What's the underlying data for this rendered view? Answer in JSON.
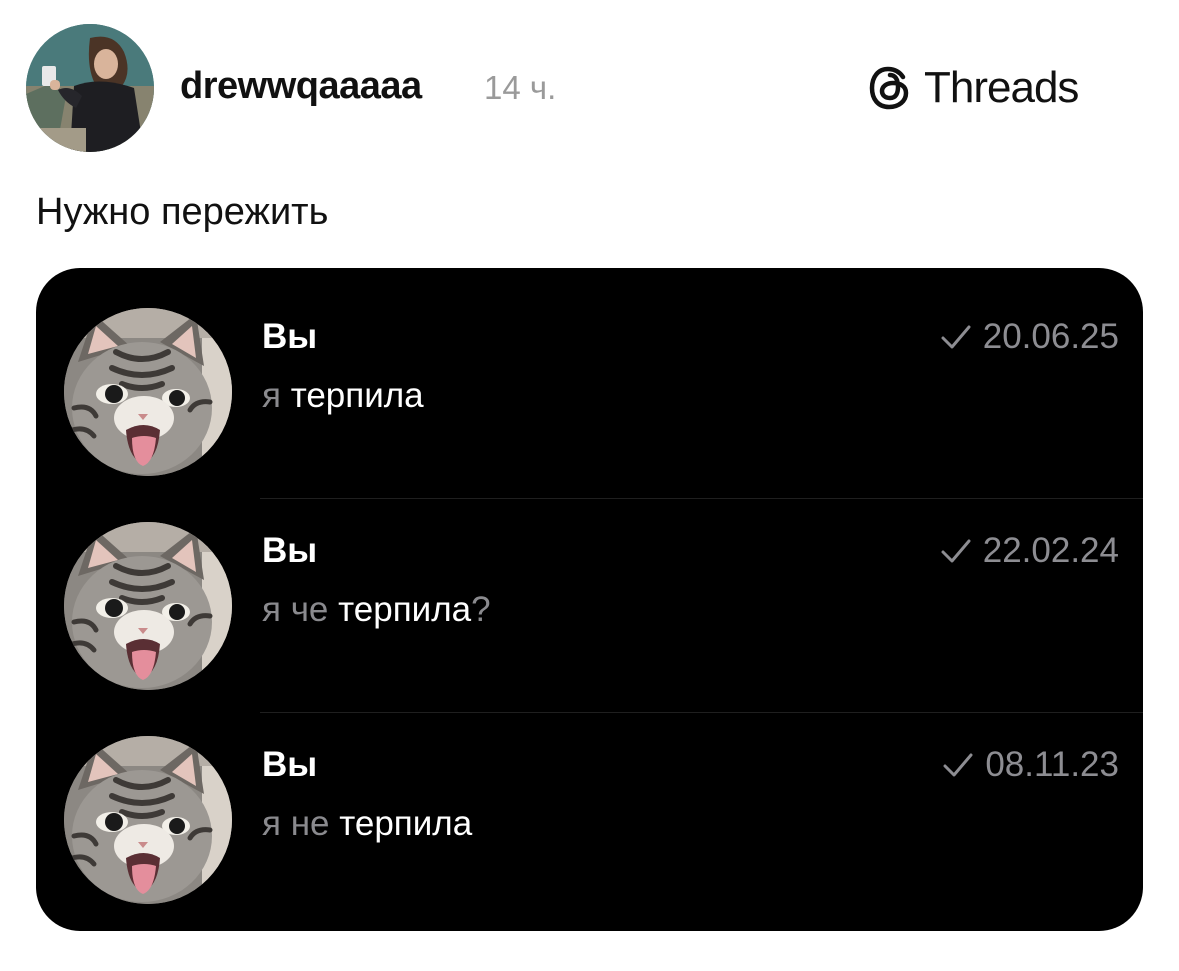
{
  "post": {
    "username": "drewwqaaaaa",
    "time": "14 ч.",
    "text": "Нужно пережить"
  },
  "brand": {
    "label": "Threads",
    "icon": "threads-logo-icon"
  },
  "chat": {
    "rows": [
      {
        "sender": "Вы",
        "prefix": "я",
        "mid": "",
        "main": "терпила",
        "punct": "",
        "date": "20.06.25",
        "icon": "single-check-icon"
      },
      {
        "sender": "Вы",
        "prefix": "я",
        "mid": "че",
        "main": "терпила",
        "punct": "?",
        "date": "22.02.24",
        "icon": "single-check-icon"
      },
      {
        "sender": "Вы",
        "prefix": "я",
        "mid": "не",
        "main": "терпила",
        "punct": "",
        "date": "08.11.23",
        "icon": "single-check-icon"
      }
    ]
  },
  "colors": {
    "card_background": "#000000",
    "secondary_text": "#8a8a8e",
    "timestamp_text": "#9a9a9a"
  }
}
